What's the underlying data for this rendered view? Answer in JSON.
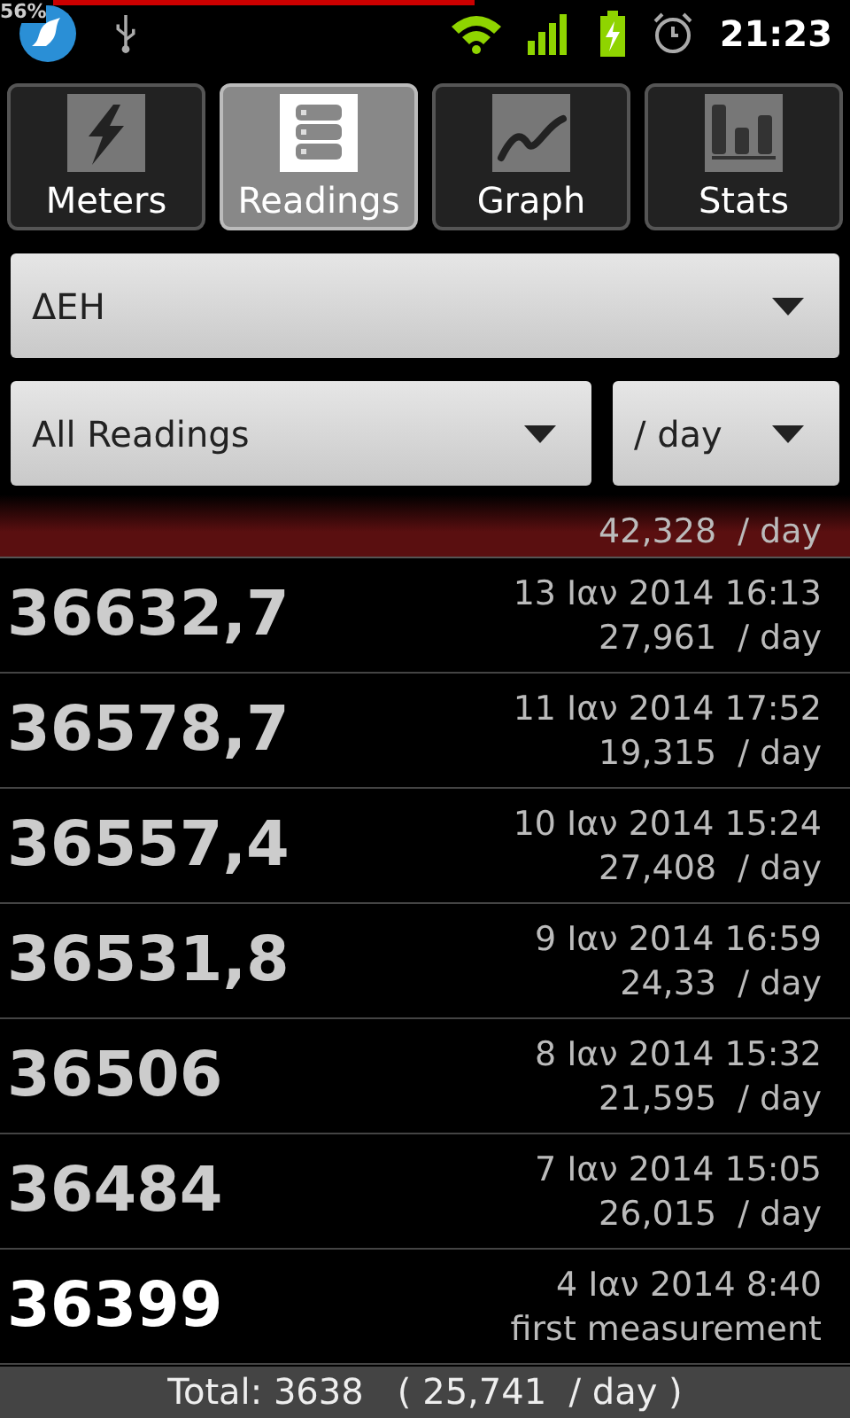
{
  "status_bar": {
    "battery_overlay": "56%",
    "time": "21:23"
  },
  "tabs": [
    {
      "label": "Meters",
      "selected": false
    },
    {
      "label": "Readings",
      "selected": true
    },
    {
      "label": "Graph",
      "selected": false
    },
    {
      "label": "Stats",
      "selected": false
    }
  ],
  "meter_dropdown": {
    "value": "ΔΕΗ"
  },
  "filter_dropdown": {
    "value": "All Readings"
  },
  "unit_dropdown": {
    "value": "/ day"
  },
  "partial_row": {
    "rate": "42,328  / day",
    "selected": true
  },
  "rows": [
    {
      "value": "36632,7",
      "date": "13 Ιαν 2014 16:13",
      "rate": "27,961  / day",
      "emphasized": false,
      "selected": false
    },
    {
      "value": "36578,7",
      "date": "11 Ιαν 2014 17:52",
      "rate": "19,315  / day",
      "emphasized": false,
      "selected": false
    },
    {
      "value": "36557,4",
      "date": "10 Ιαν 2014 15:24",
      "rate": "27,408  / day",
      "emphasized": false,
      "selected": false
    },
    {
      "value": "36531,8",
      "date": "9 Ιαν 2014 16:59",
      "rate": "24,33  / day",
      "emphasized": false,
      "selected": false
    },
    {
      "value": "36506",
      "date": "8 Ιαν 2014 15:32",
      "rate": "21,595  / day",
      "emphasized": false,
      "selected": false
    },
    {
      "value": "36484",
      "date": "7 Ιαν 2014 15:05",
      "rate": "26,015  / day",
      "emphasized": false,
      "selected": false
    },
    {
      "value": "36399",
      "date": "4 Ιαν 2014 8:40",
      "rate": "first measurement",
      "emphasized": true,
      "selected": false
    }
  ],
  "footer": {
    "total": "Total: 3638   ( 25,741  / day )"
  }
}
